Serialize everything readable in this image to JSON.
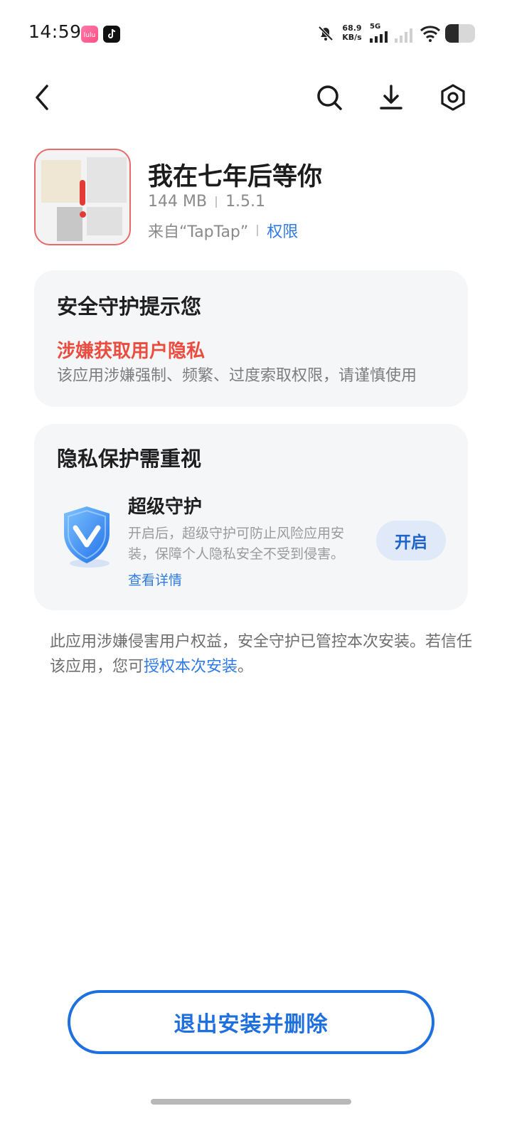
{
  "status_bar": {
    "time": "14:59",
    "network_speed_value": "68.9",
    "network_speed_unit": "KB/s",
    "network_type": "5G",
    "battery_level": 0.45,
    "icons": [
      "app-icon-pink",
      "tiktok-icon",
      "bell-muted-icon",
      "signal-icon",
      "signal-icon",
      "wifi-icon",
      "battery-icon"
    ]
  },
  "nav": {
    "icons": [
      "back-icon",
      "search-icon",
      "download-icon",
      "settings-icon"
    ]
  },
  "app": {
    "name": "我在七年后等你",
    "size": "144 MB",
    "version": "1.5.1",
    "source": "来自“TapTap”",
    "permissions_link": "权限"
  },
  "security_card": {
    "title": "安全守护提示您",
    "warning_title": "涉嫌获取用户隐私",
    "warning_desc": "该应用涉嫌强制、频繁、过度索取权限，请谨慎使用"
  },
  "privacy_card": {
    "title": "隐私保护需重视",
    "protection_title": "超级守护",
    "protection_desc": "开启后，超级守护可防止风险应用安装，保障个人隐私安全不受到侵害。",
    "details_link": "查看详情",
    "enable_button": "开启"
  },
  "notice": {
    "text_prefix": "此应用涉嫌侵害用户权益，安全守护已管控本次安装。若信任该应用，您可",
    "link": "授权本次安装",
    "suffix": "。"
  },
  "exit_button": "退出安装并删除",
  "colors": {
    "accent": "#1e6fe0",
    "warning": "#ea4c3f",
    "card_bg": "#f5f6f8"
  }
}
